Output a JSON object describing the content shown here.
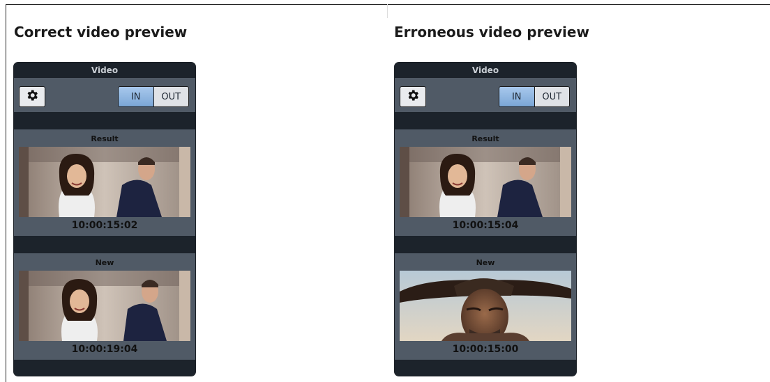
{
  "previews": [
    {
      "heading": "Correct video preview",
      "panel": {
        "title": "Video",
        "settings_icon": "gear-icon",
        "toggle": {
          "in_label": "IN",
          "out_label": "OUT",
          "selected": "IN"
        },
        "result": {
          "label": "Result",
          "thumbnail": "couple-wedding-scene",
          "timecode": "10:00:15:02"
        },
        "new": {
          "label": "New",
          "thumbnail": "couple-wedding-scene",
          "timecode": "10:00:19:04"
        }
      }
    },
    {
      "heading": "Erroneous video preview",
      "panel": {
        "title": "Video",
        "settings_icon": "gear-icon",
        "toggle": {
          "in_label": "IN",
          "out_label": "OUT",
          "selected": "IN"
        },
        "result": {
          "label": "Result",
          "thumbnail": "couple-wedding-scene",
          "timecode": "10:00:15:04"
        },
        "new": {
          "label": "New",
          "thumbnail": "cowboy-portrait-scene",
          "timecode": "10:00:15:00"
        }
      }
    }
  ],
  "colors": {
    "panel_bg": "#505a66",
    "panel_dark": "#1c232b",
    "active_toggle": "#8fb6e2"
  }
}
